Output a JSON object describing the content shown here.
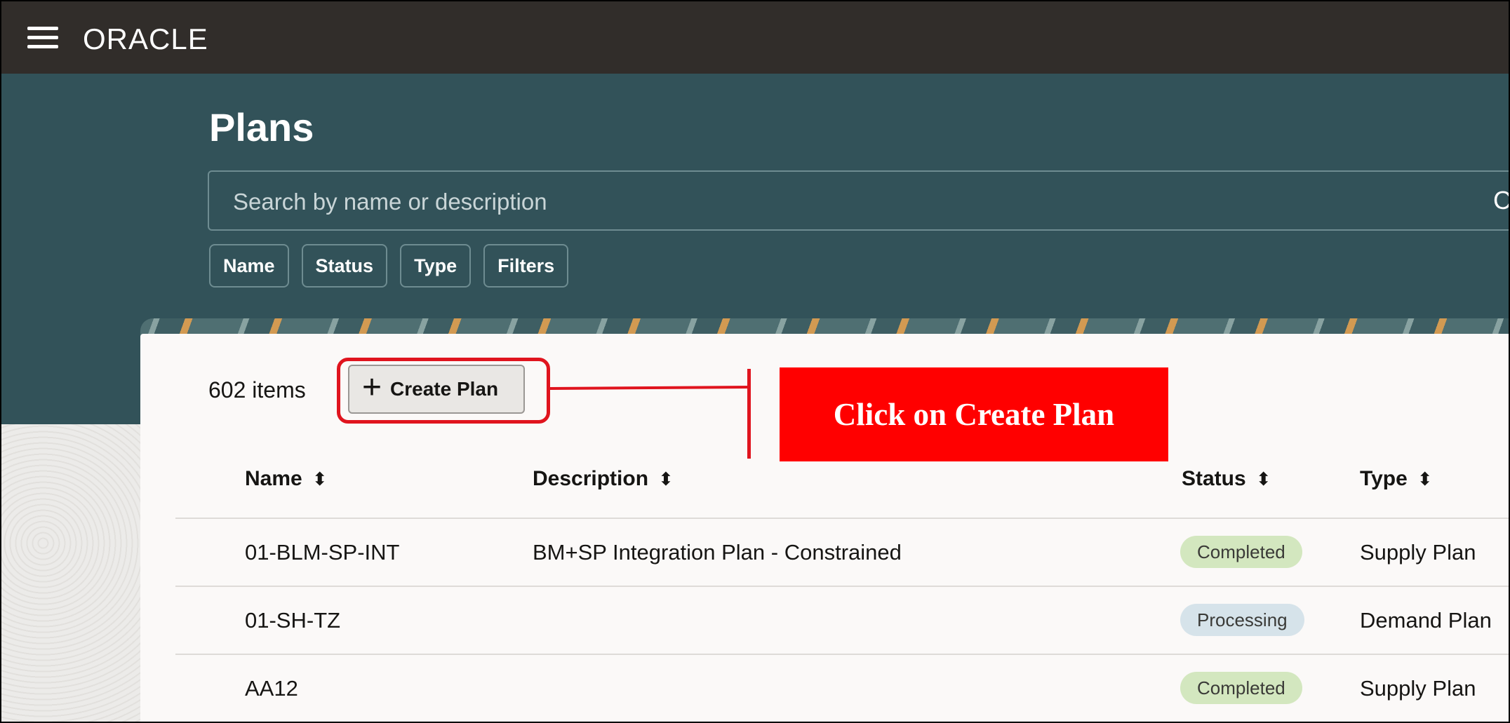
{
  "app": {
    "logo": "ORACLE"
  },
  "page": {
    "title": "Plans"
  },
  "search": {
    "placeholder": "Search by name or description",
    "overflow_glyph": "C"
  },
  "filters": [
    "Name",
    "Status",
    "Type",
    "Filters"
  ],
  "list": {
    "count": "602 items",
    "create_label": "Create Plan",
    "create_icon": "plus-icon"
  },
  "callout": {
    "text": "Click on Create Plan",
    "color": "#ff0000"
  },
  "table": {
    "columns": [
      "Name",
      "Description",
      "Status",
      "Type"
    ],
    "rows": [
      {
        "name": "01-BLM-SP-INT",
        "description": "BM+SP Integration Plan - Constrained",
        "status": "Completed",
        "type": "Supply Plan"
      },
      {
        "name": "01-SH-TZ",
        "description": "",
        "status": "Processing",
        "type": "Demand Plan"
      },
      {
        "name": "AA12",
        "description": "",
        "status": "Completed",
        "type": "Supply Plan"
      }
    ]
  },
  "colors": {
    "topbar": "#312d2a",
    "header": "#325259",
    "completed": "#d3e7bf",
    "processing": "#d6e3ea"
  }
}
